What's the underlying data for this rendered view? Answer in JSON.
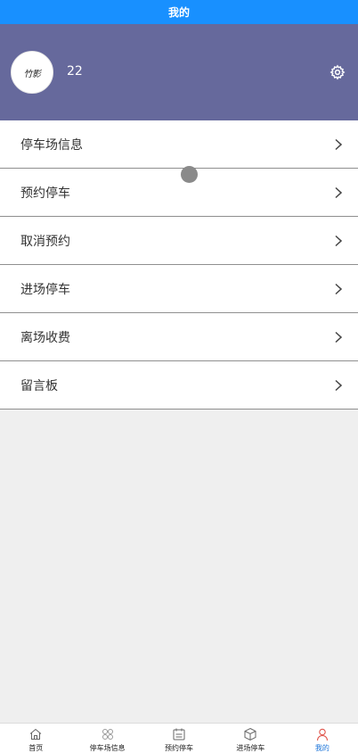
{
  "header": {
    "title": "我的"
  },
  "profile": {
    "avatar_text": "竹影",
    "username": "22"
  },
  "menu": {
    "items": [
      {
        "label": "停车场信息"
      },
      {
        "label": "预约停车"
      },
      {
        "label": "取消预约"
      },
      {
        "label": "进场停车"
      },
      {
        "label": "离场收费"
      },
      {
        "label": "留言板"
      }
    ]
  },
  "tabbar": {
    "tabs": [
      {
        "label": "首页",
        "icon": "home-icon"
      },
      {
        "label": "停车场信息",
        "icon": "grid-icon"
      },
      {
        "label": "预约停车",
        "icon": "calendar-icon"
      },
      {
        "label": "进场停车",
        "icon": "box-icon"
      },
      {
        "label": "我的",
        "icon": "user-icon",
        "active": true
      }
    ]
  },
  "colors": {
    "titlebar": "#1890ff",
    "profile_bg": "#66699c",
    "active_tab": "#1a73d9"
  }
}
